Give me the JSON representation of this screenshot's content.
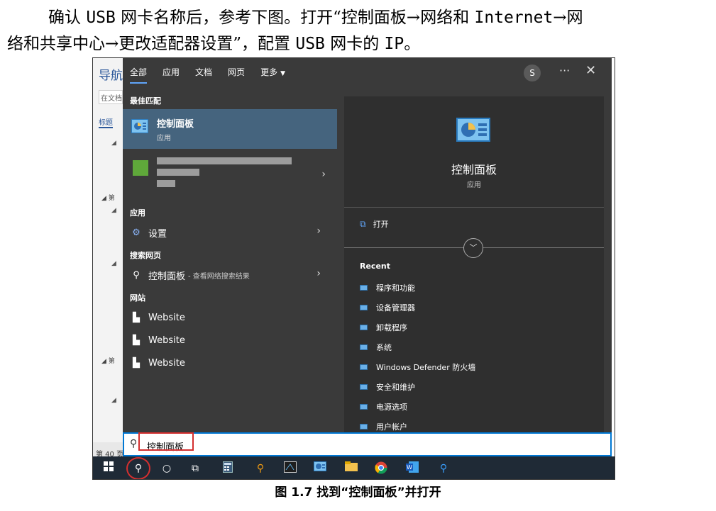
{
  "document": {
    "line1_a": "确认 ",
    "line1_b": "USB",
    "line1_c": " 网卡名称后，参考下图。打开“控制面板→网络和 ",
    "line1_d": "Internet",
    "line1_e": "→网",
    "line2_a": "络和共享中心→更改适配器设置”，配置 ",
    "line2_b": "USB",
    "line2_c": " 网卡的 ",
    "line2_d": "IP",
    "line2_e": "。",
    "caption": "图 1.7 找到“控制面板”并打开"
  },
  "word_background": {
    "nav_title": "导航",
    "search_placeholder": "在文档中搜索",
    "tab": "标题",
    "chapter_label_a": "第",
    "chapter_label_b": "第",
    "status": "第 40 页"
  },
  "search_panel": {
    "tabs": [
      {
        "label": "全部",
        "active": true
      },
      {
        "label": "应用"
      },
      {
        "label": "文档"
      },
      {
        "label": "网页"
      },
      {
        "label": "更多"
      }
    ],
    "avatar": "S",
    "more_icon": "···",
    "close_icon": "✕",
    "best_match": {
      "header": "最佳匹配",
      "title": "控制面板",
      "subtitle": "应用"
    },
    "apps_header": "应用",
    "settings_item": "设置",
    "web_header": "搜索网页",
    "web_item": "控制面板",
    "web_item_sub": "- 查看网络搜索结果",
    "sites_header": "网站",
    "sites": [
      "Website",
      "Website",
      "Website"
    ],
    "detail": {
      "title": "控制面板",
      "subtitle": "应用",
      "open": "打开",
      "recent_header": "Recent",
      "recent": [
        "程序和功能",
        "设备管理器",
        "卸载程序",
        "系统",
        "Windows Defender 防火墙",
        "安全和维护",
        "电源选项",
        "用户帐户"
      ]
    },
    "search_value": "控制面板"
  },
  "colors": {
    "accent": "#0078d4",
    "highlight": "#d32f2f",
    "panel_bg": "#3a3a3a",
    "selected_bg": "#45647e"
  }
}
